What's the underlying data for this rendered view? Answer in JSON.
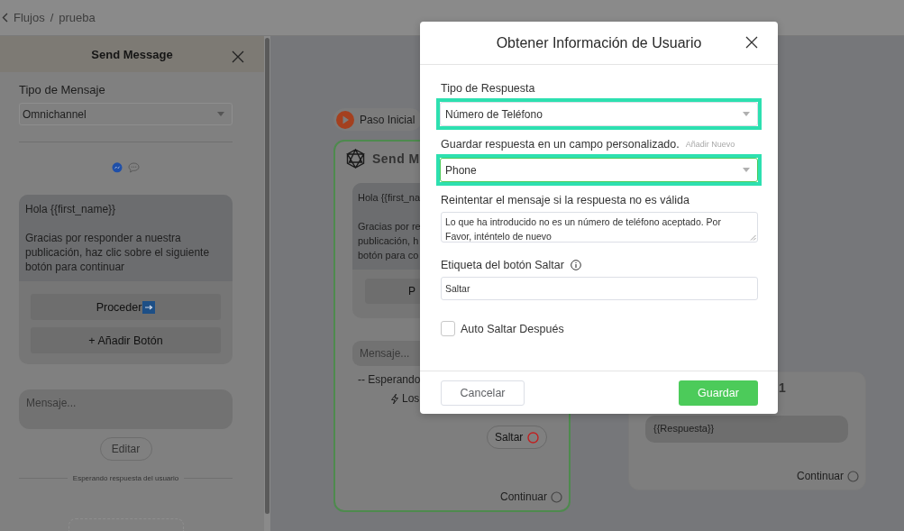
{
  "breadcrumb": {
    "back": "Flujos",
    "separator": "/",
    "current": "prueba"
  },
  "side_panel": {
    "title": "Send Message",
    "type_label": "Tipo de Mensaje",
    "type_value": "Omnichannel",
    "message": {
      "greeting": "Hola {{first_name}}",
      "body": "Gracias por responder a nuestra publicación, haz clic sobre el siguiente botón para continuar"
    },
    "buttons": [
      {
        "kind": "action",
        "label": "Proceder"
      },
      {
        "kind": "add",
        "label": "+ Añadir Botón"
      }
    ],
    "input_placeholder": "Mensaje...",
    "edit_button": "Editar",
    "waiting_label": "Esperando respuesta del usuario"
  },
  "canvas": {
    "start_label": "Paso Inicial",
    "send_node": {
      "title": "Send M",
      "lines": [
        "Hola {{first_na",
        "Gracias por re",
        "publicación, h",
        "botón para co"
      ],
      "button": "P",
      "input_placeholder": "Mensaje...",
      "waiting": "-- Esperando",
      "trigger": "Los",
      "skip_button": "Saltar",
      "continue_label": "Continuar"
    },
    "result_node": {
      "title": "1",
      "variable": "{{Respuesta}}",
      "continue_label": "Continuar"
    }
  },
  "modal": {
    "title": "Obtener Información de Usuario",
    "response_type": {
      "label": "Tipo de Respuesta",
      "value": "Número de Teléfono",
      "highlighted": true
    },
    "save_field": {
      "label": "Guardar respuesta en un campo personalizado.",
      "link": "Añadir Nuevo",
      "value": "Phone",
      "highlighted": true
    },
    "retry": {
      "label": "Reintentar el mensaje si la respuesta no es válida",
      "value": "Lo que ha introducido no es un número de teléfono aceptado. Por Favor, inténtelo de nuevo"
    },
    "skip_label": {
      "label": "Etiqueta del botón Saltar",
      "value": "Saltar"
    },
    "auto_skip": {
      "label": "Auto Saltar Después",
      "checked": false
    },
    "buttons": [
      {
        "kind": "cancel",
        "label": "Cancelar"
      },
      {
        "kind": "save",
        "label": "Guardar"
      }
    ]
  }
}
